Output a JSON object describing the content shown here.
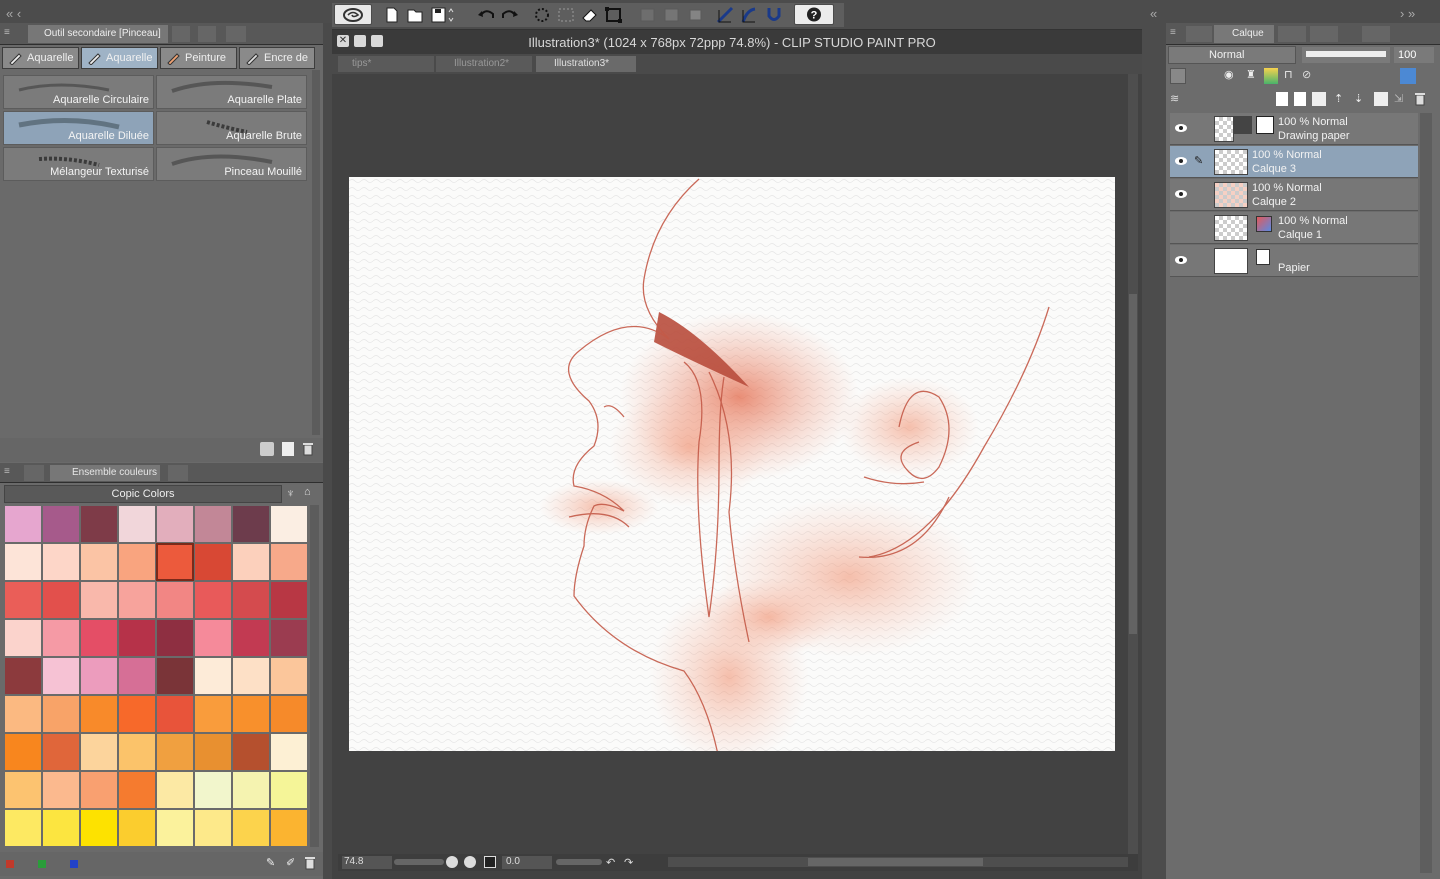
{
  "window": {
    "title": "Illustration3* (1024 x 768px 72ppp 74.8%)  - CLIP STUDIO PAINT PRO",
    "doc_tabs": [
      "tips*",
      "Illustration2*",
      "Illustration3*"
    ]
  },
  "left_panel": {
    "subtool_header": "Outil secondaire [Pinceau]",
    "tool_tabs": [
      "Aquarelle",
      "Aquarelle",
      "Peinture",
      "Encre de"
    ],
    "brushes": [
      "Aquarelle Circulaire",
      "Aquarelle Plate",
      "Aquarelle Diluée",
      "Aquarelle Brute",
      "Mélangeur Texturisé",
      "Pinceau Mouillé"
    ],
    "color_header": "Ensemble couleurs",
    "color_set": "Copic Colors",
    "swatches": [
      "#e6a6cf",
      "#a65a8b",
      "#7e3b48",
      "#f1d6da",
      "#e2aebc",
      "#c28797",
      "#6d3c4c",
      "#fbeee3",
      "#fde4d8",
      "#fdd6c8",
      "#fbc4a5",
      "#f9a47f",
      "#ec5a3c",
      "#d84834",
      "#fcd0bc",
      "#f7a98a",
      "#ea5e58",
      "#e2504c",
      "#f9b8ab",
      "#f7a39c",
      "#f28684",
      "#e85a5a",
      "#d44b4e",
      "#b83744",
      "#fbd3cc",
      "#f59aa5",
      "#e44e66",
      "#b63249",
      "#8e2f41",
      "#f58a9a",
      "#c23a52",
      "#9b3c50",
      "#8c3a3d",
      "#f6c2d4",
      "#ec9cbd",
      "#d66f96",
      "#7a3438",
      "#fdebd8",
      "#fde0c6",
      "#fbc69b",
      "#fbb981",
      "#f8a368",
      "#f88a2a",
      "#f7692a",
      "#e8543a",
      "#f99c3c",
      "#f8902c",
      "#f68a2a",
      "#f8861e",
      "#e0663a",
      "#fcd49c",
      "#fbc36a",
      "#f0a040",
      "#e89030",
      "#b5502e",
      "#fdf0d4",
      "#fcc370",
      "#fbb98e",
      "#f9a070",
      "#f57b2f",
      "#fce9a4",
      "#f2f6cc",
      "#f5f3b0",
      "#f5f598",
      "#fde962",
      "#fce540",
      "#fde200",
      "#fbcd2e",
      "#fbf29c",
      "#fde98a",
      "#fcd34c",
      "#fbb430"
    ],
    "bottom_colors": [
      "#c0392b",
      "#2a9d3a",
      "#2242c8"
    ]
  },
  "status": {
    "zoom": "74.8",
    "angle": "0.0"
  },
  "layers_panel": {
    "tab_label": "Calque",
    "blend_mode": "Normal",
    "opacity": "100",
    "layers": [
      {
        "mode": "100 % Normal",
        "name": "Drawing paper",
        "selected": false
      },
      {
        "mode": "100 % Normal",
        "name": "Calque 3",
        "selected": true
      },
      {
        "mode": "100 % Normal",
        "name": "Calque 2",
        "selected": false
      },
      {
        "mode": "100 % Normal",
        "name": "Calque 1",
        "selected": false
      },
      {
        "mode": "",
        "name": "Papier",
        "selected": false
      }
    ]
  },
  "icons": [
    "app-logo-icon",
    "new-file-icon",
    "open-file-icon",
    "save-icon",
    "undo-icon",
    "redo-icon",
    "selection-icon",
    "transform-icon",
    "help-icon",
    "eye-icon",
    "pen-icon",
    "trash-icon",
    "folder-icon",
    "lock-icon"
  ]
}
